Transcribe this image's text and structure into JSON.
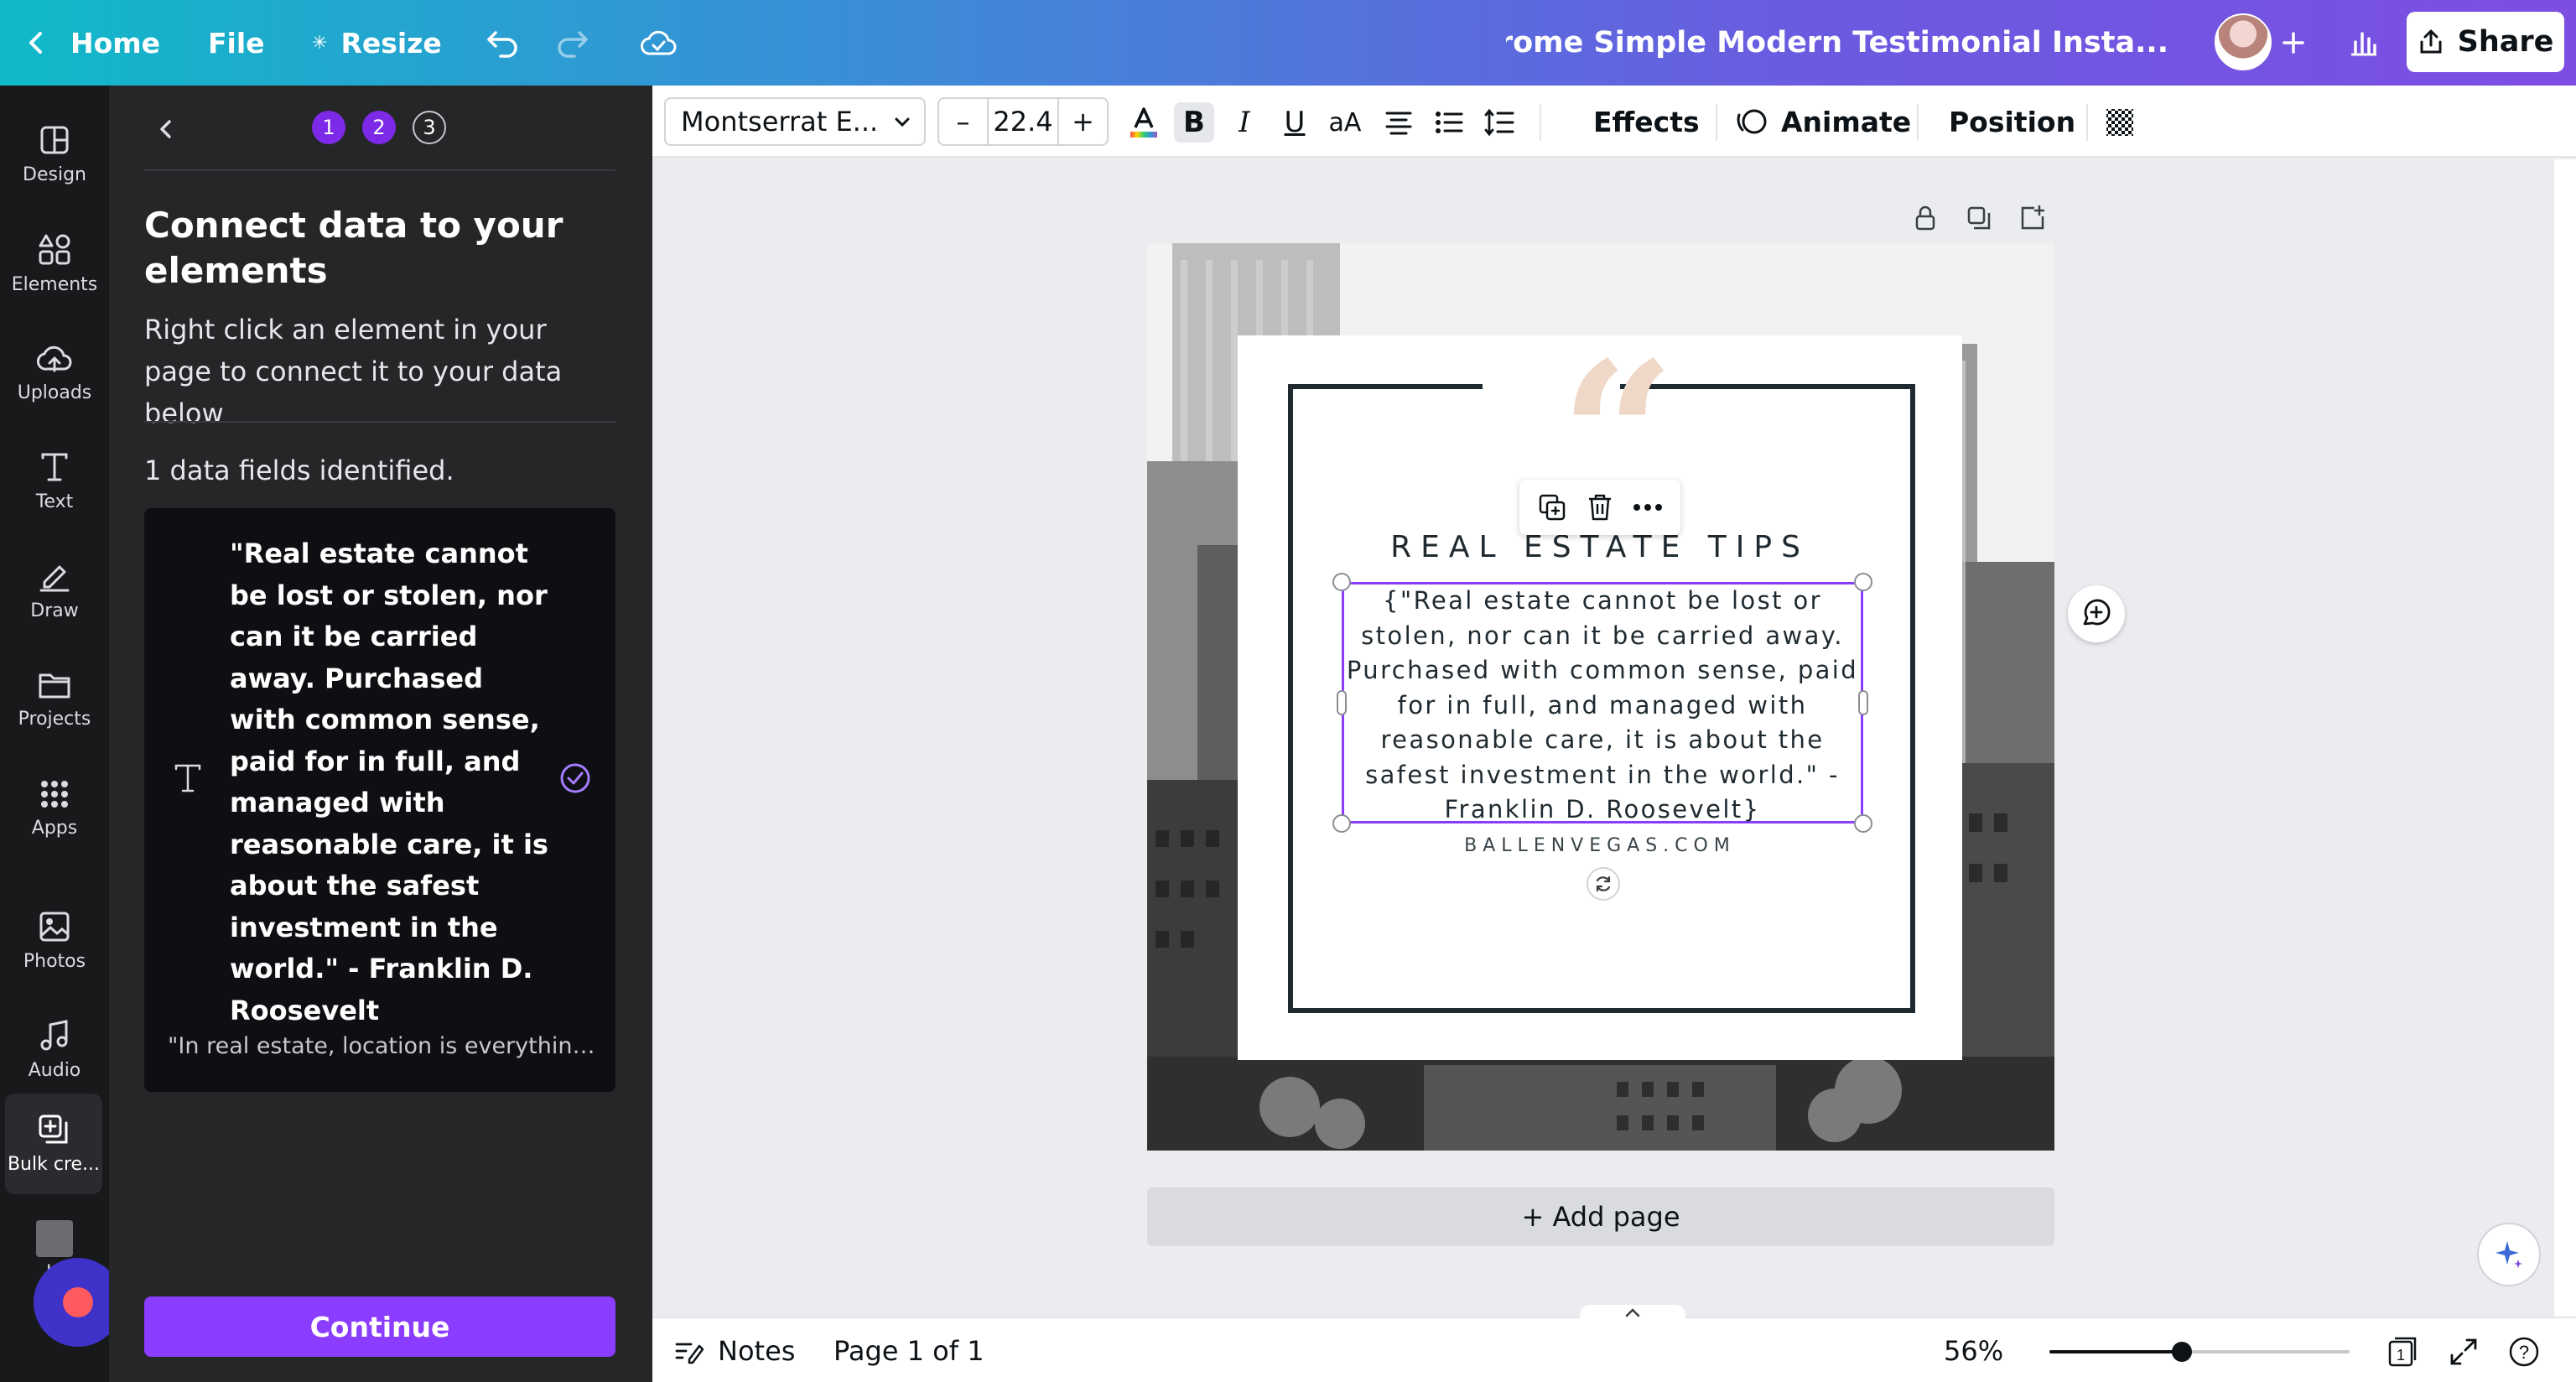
{
  "topbar": {
    "home": "Home",
    "file": "File",
    "resize": "Resize",
    "title": "Monochrome Simple Modern Testimonial Insta...",
    "share": "Share"
  },
  "rail": {
    "items": [
      {
        "label": "Design"
      },
      {
        "label": "Elements"
      },
      {
        "label": "Uploads"
      },
      {
        "label": "Text"
      },
      {
        "label": "Draw"
      },
      {
        "label": "Projects"
      },
      {
        "label": "Apps"
      },
      {
        "label": "Photos"
      },
      {
        "label": "Audio"
      },
      {
        "label": "Bulk cre..."
      },
      {
        "label": "Jo"
      }
    ]
  },
  "panel": {
    "steps": [
      "1",
      "2",
      "3"
    ],
    "title": "Connect data to your elements",
    "subtitle": "Right click an element in your page to connect it to your data below",
    "fields_count": "1 data fields identified.",
    "field_text": "\"Real estate cannot be lost or stolen, nor can it be carried away. Purchased with common sense, paid for in full, and managed with reasonable care, it is about the safest investment in the world.\" - Franklin D. Roosevelt",
    "field_next": "\"In real estate, location is everything...",
    "continue": "Continue"
  },
  "toolbar": {
    "font": "Montserrat E...",
    "size_minus": "–",
    "size_value": "22.4",
    "size_plus": "+",
    "effects": "Effects",
    "animate": "Animate",
    "position": "Position"
  },
  "design": {
    "heading": "REAL ESTATE TIPS",
    "quote": "{\"Real estate cannot be lost or stolen, nor can it be carried away. Purchased with common sense, paid for in full, and managed with reasonable care, it is about the safest investment in the world.\" - Franklin D. Roosevelt}",
    "website": "BALLENVEGAS.COM",
    "quote_mark": "“"
  },
  "canvas": {
    "add_page": "+ Add page"
  },
  "bottombar": {
    "notes": "Notes",
    "page": "Page 1 of 1",
    "zoom": "56%",
    "zoom_level": 0.44,
    "page_count": "1",
    "help": "?"
  },
  "colors": {
    "accent": "#8b3dff",
    "panel_bg": "#252627",
    "rail_bg": "#18191b",
    "quote_mark": "#f0d8c9"
  }
}
